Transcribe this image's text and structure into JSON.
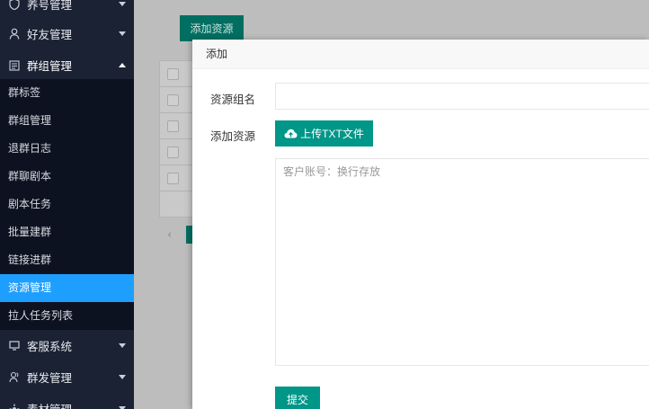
{
  "sidebar": {
    "groups_top": [
      {
        "icon": "shield-icon",
        "label": "养号管理"
      },
      {
        "icon": "user-icon",
        "label": "好友管理"
      },
      {
        "icon": "group-list-icon",
        "label": "群组管理"
      }
    ],
    "sub_items": [
      {
        "label": "群标签",
        "active": false
      },
      {
        "label": "群组管理",
        "active": false
      },
      {
        "label": "退群日志",
        "active": false
      },
      {
        "label": "群聊剧本",
        "active": false
      },
      {
        "label": "剧本任务",
        "active": false
      },
      {
        "label": "批量建群",
        "active": false
      },
      {
        "label": "链接进群",
        "active": false
      },
      {
        "label": "资源管理",
        "active": true
      },
      {
        "label": "拉人任务列表",
        "active": false
      }
    ],
    "groups_bottom": [
      {
        "icon": "monitor-icon",
        "label": "客服系统"
      },
      {
        "icon": "users-icon",
        "label": "群发管理"
      },
      {
        "icon": "material-icon",
        "label": "素材管理"
      }
    ]
  },
  "main": {
    "add_resource_label": "添加资源"
  },
  "modal": {
    "title": "添加",
    "group_name_label": "资源组名",
    "group_name_value": "",
    "add_resource_label": "添加资源",
    "upload_label": "上传TXT文件",
    "accounts_placeholder": "客户账号：换行存放",
    "submit_label": "提交"
  },
  "colors": {
    "sidebar_bg": "#1b2233",
    "submenu_bg": "#0d1220",
    "active_item": "#1e9fff",
    "primary_button": "#009688"
  }
}
